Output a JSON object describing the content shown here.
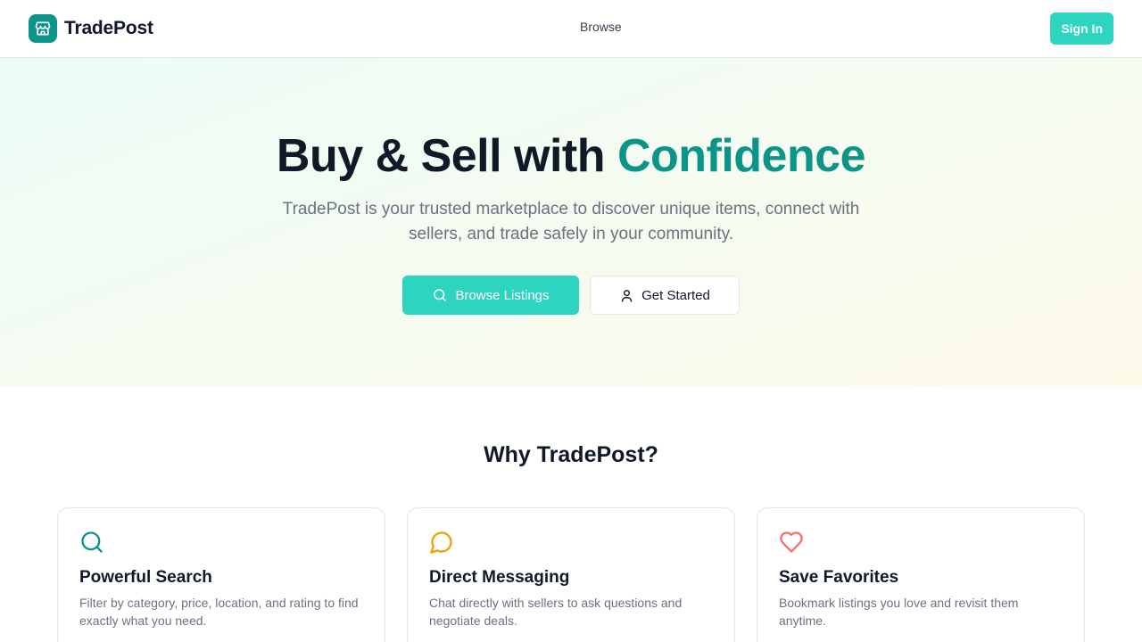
{
  "header": {
    "brand_name": "TradePost",
    "nav_browse": "Browse",
    "signin_label": "Sign In"
  },
  "hero": {
    "title_main": "Buy & Sell with ",
    "title_accent": "Confidence",
    "subtitle": "TradePost is your trusted marketplace to discover unique items, connect with sellers, and trade safely in your community.",
    "primary_label": "Browse Listings",
    "secondary_label": "Get Started"
  },
  "features": {
    "title": "Why TradePost?",
    "items": [
      {
        "icon": "search-icon",
        "title": "Powerful Search",
        "desc": "Filter by category, price, location, and rating to find exactly what you need."
      },
      {
        "icon": "chat-bubble-icon",
        "title": "Direct Messaging",
        "desc": "Chat directly with sellers to ask questions and negotiate deals."
      },
      {
        "icon": "heart-icon",
        "title": "Save Favorites",
        "desc": "Bookmark listings you love and revisit them anytime."
      }
    ]
  },
  "colors": {
    "brand": "#0d9488",
    "accent_button": "#2dd4bf",
    "message_icon": "#f59e0b",
    "heart_icon": "#f87171"
  }
}
